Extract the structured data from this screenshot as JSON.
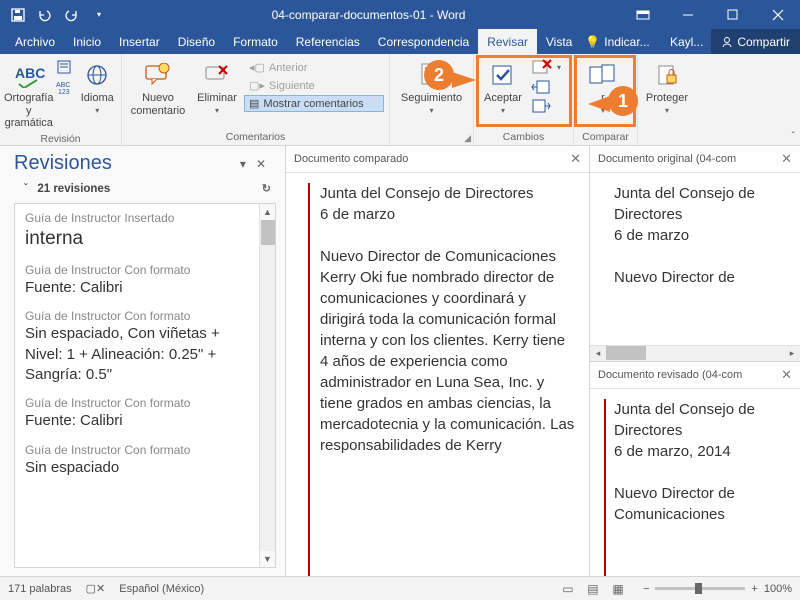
{
  "titlebar": {
    "title": "04-comparar-documentos-01 - Word"
  },
  "tabs": {
    "archivo": "Archivo",
    "inicio": "Inicio",
    "insertar": "Insertar",
    "diseno": "Diseño",
    "formato": "Formato",
    "referencias": "Referencias",
    "correspondencia": "Correspondencia",
    "revisar": "Revisar",
    "vista": "Vista",
    "tell": "Indicar...",
    "user": "Kayl...",
    "compartir": "Compartir"
  },
  "ribbon": {
    "revision": {
      "ortografia": "Ortografía y gramática",
      "idioma": "Idioma",
      "group": "Revisión"
    },
    "comentarios": {
      "nuevo": "Nuevo comentario",
      "eliminar": "Eliminar",
      "anterior": "Anterior",
      "siguiente": "Siguiente",
      "mostrar": "Mostrar comentarios",
      "group": "Comentarios"
    },
    "seguimiento": {
      "label": "Seguimiento",
      "group": ""
    },
    "cambios": {
      "aceptar": "Aceptar",
      "group": "Cambios"
    },
    "comparar": {
      "label": "r",
      "group": "Comparar"
    },
    "proteger": {
      "label": "Proteger",
      "group": ""
    }
  },
  "revisions": {
    "title": "Revisiones",
    "count": "21 revisiones",
    "items": [
      {
        "meta": "Guía de Instructor Insertado",
        "body": "interna"
      },
      {
        "meta": "Guía de Instructor Con formato",
        "body": "Fuente: Calibri"
      },
      {
        "meta": "Guía de Instructor Con formato",
        "body": "Sin espaciado, Con viñetas + Nivel: 1 + Alineación:  0.25\" + Sangría:  0.5\""
      },
      {
        "meta": "Guía de Instructor Con formato",
        "body": "Fuente: Calibri"
      },
      {
        "meta": "Guía de Instructor Con formato",
        "body": "Sin espaciado"
      }
    ]
  },
  "panes": {
    "compared": {
      "title": "Documento comparado",
      "p1": "Junta del Consejo de Directores",
      "p1b": "6 de marzo",
      "p2h": "Nuevo Director de Comunicaciones",
      "p2": "Kerry Oki fue nombrado director de comunicaciones y coordinará y dirigirá toda la comunicación formal interna y con los clientes. Kerry tiene 4 años de experiencia como administrador en Luna Sea, Inc. y tiene grados en ambas ciencias, la mercadotecnia y la comunicación. Las responsabilidades de Kerry"
    },
    "original": {
      "title": "Documento original (04-com",
      "p1": "Junta del Consejo de Directores",
      "p1b": "6 de marzo",
      "p2h": "Nuevo Director de"
    },
    "revised": {
      "title": "Documento revisado (04-com",
      "p1": "Junta del Consejo de Directores",
      "p1b": "6 de marzo, 2014",
      "p2h": "Nuevo Director de Comunicaciones"
    }
  },
  "statusbar": {
    "words": "171 palabras",
    "lang": "Español (México)",
    "zoom": "100%"
  },
  "callouts": {
    "one": "1",
    "two": "2"
  }
}
